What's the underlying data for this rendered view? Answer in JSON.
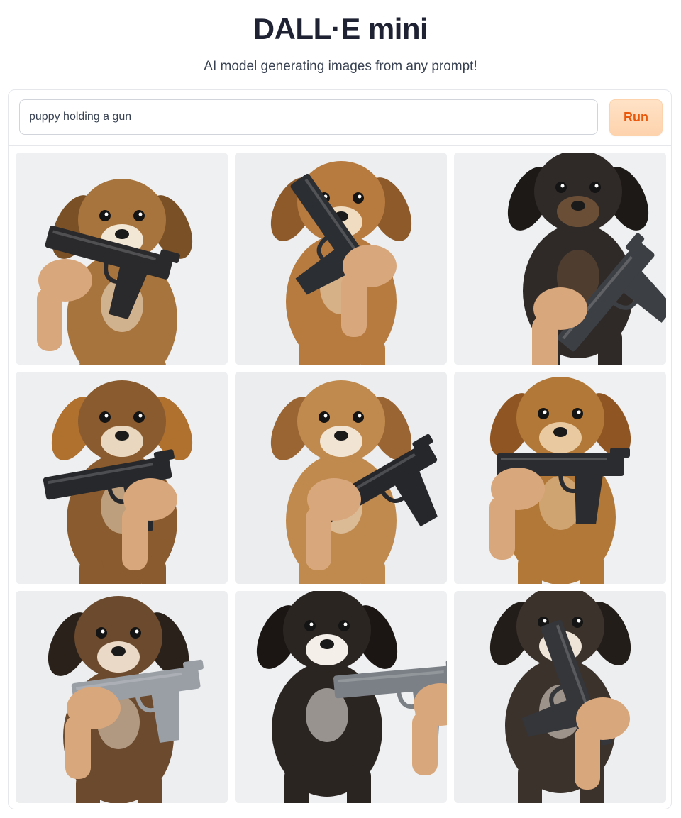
{
  "app": {
    "title": "DALL·E mini",
    "subtitle": "AI model generating images from any prompt!"
  },
  "prompt": {
    "value": "puppy holding a gun"
  },
  "run_button": {
    "label": "Run",
    "background": "#fdd9b8",
    "text_color": "#ea580c"
  },
  "results": [
    {
      "subject": "puppy-with-pistol",
      "fur": "#a8743d",
      "ear": "#7a5127",
      "muzzle": "#f2e6d4",
      "gun": "#2a2a2d",
      "bg": "#eef0f2"
    },
    {
      "subject": "puppy-with-pistol",
      "fur": "#b77b40",
      "ear": "#8e5a2a",
      "muzzle": "#f0dcc0",
      "gun": "#2b2e33",
      "bg": "#eceeef"
    },
    {
      "subject": "puppy-with-pistol",
      "fur": "#2f2a28",
      "ear": "#1c1917",
      "muzzle": "#6a4e36",
      "gun": "#3c3f44",
      "bg": "#eef0f1"
    },
    {
      "subject": "puppy-with-pistol",
      "fur": "#8a5b2e",
      "ear": "#b0702e",
      "muzzle": "#e9d7bf",
      "gun": "#26282b",
      "bg": "#edeff0"
    },
    {
      "subject": "puppy-with-pistol",
      "fur": "#c08a4e",
      "ear": "#9a6433",
      "muzzle": "#f1e4d2",
      "gun": "#25272b",
      "bg": "#ebedee"
    },
    {
      "subject": "puppy-with-pistol",
      "fur": "#b27838",
      "ear": "#8f5623",
      "muzzle": "#e8c9a0",
      "gun": "#2b2c2f",
      "bg": "#eff0f1"
    },
    {
      "subject": "puppy-with-pistol",
      "fur": "#6b4a2e",
      "ear": "#2a211b",
      "muzzle": "#e9d9c6",
      "gun": "#9a9fa6",
      "bg": "#eceeef"
    },
    {
      "subject": "puppy-with-pistol",
      "fur": "#2b2522",
      "ear": "#1b1614",
      "muzzle": "#f4efe9",
      "gun": "#7b8087",
      "bg": "#eef0f1"
    },
    {
      "subject": "puppy-with-pistol",
      "fur": "#3b322c",
      "ear": "#231d19",
      "muzzle": "#efe4d8",
      "gun": "#34363a",
      "bg": "#eceeef"
    }
  ]
}
